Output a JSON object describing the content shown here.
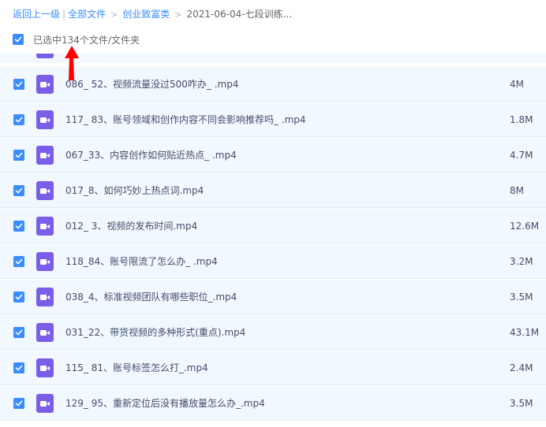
{
  "breadcrumb": {
    "back": "返回上一级",
    "all_files": "全部文件",
    "folder": "创业致富类",
    "current": "2021-06-04-七段训练..."
  },
  "selection": {
    "text": "已选中134个文件/文件夹",
    "checked": true
  },
  "files": [
    {
      "name": "086_ 52、视频流量没过500咋办_ .mp4",
      "size": "4M",
      "icon": "video-icon"
    },
    {
      "name": "117_ 83、账号领域和创作内容不同会影响推荐吗_ .mp4",
      "size": "1.8M",
      "icon": "video-icon"
    },
    {
      "name": "067_33、内容创作如何贴近热点_ .mp4",
      "size": "4.7M",
      "icon": "video-icon"
    },
    {
      "name": "017_8、如何巧妙上热点词.mp4",
      "size": "8M",
      "icon": "video-icon"
    },
    {
      "name": "012_ 3、视频的发布时间.mp4",
      "size": "12.6M",
      "icon": "video-icon"
    },
    {
      "name": "118_84、账号限流了怎么办_ .mp4",
      "size": "3.2M",
      "icon": "video-icon"
    },
    {
      "name": "038_4、标准视频团队有哪些职位_.mp4",
      "size": "3.5M",
      "icon": "video-icon"
    },
    {
      "name": "031_22、带货视频的多种形式(重点).mp4",
      "size": "43.1M",
      "icon": "video-icon"
    },
    {
      "name": "115_ 81、账号标签怎么打_.mp4",
      "size": "2.4M",
      "icon": "video-icon"
    },
    {
      "name": "129_ 95、重新定位后没有播放量怎么办_.mp4",
      "size": "3.5M",
      "icon": "video-icon"
    }
  ],
  "colors": {
    "accent": "#3b8cff",
    "row_bg": "#f1f8ff",
    "video_icon": "#7b5ee8",
    "annotation": "#ff0000"
  }
}
